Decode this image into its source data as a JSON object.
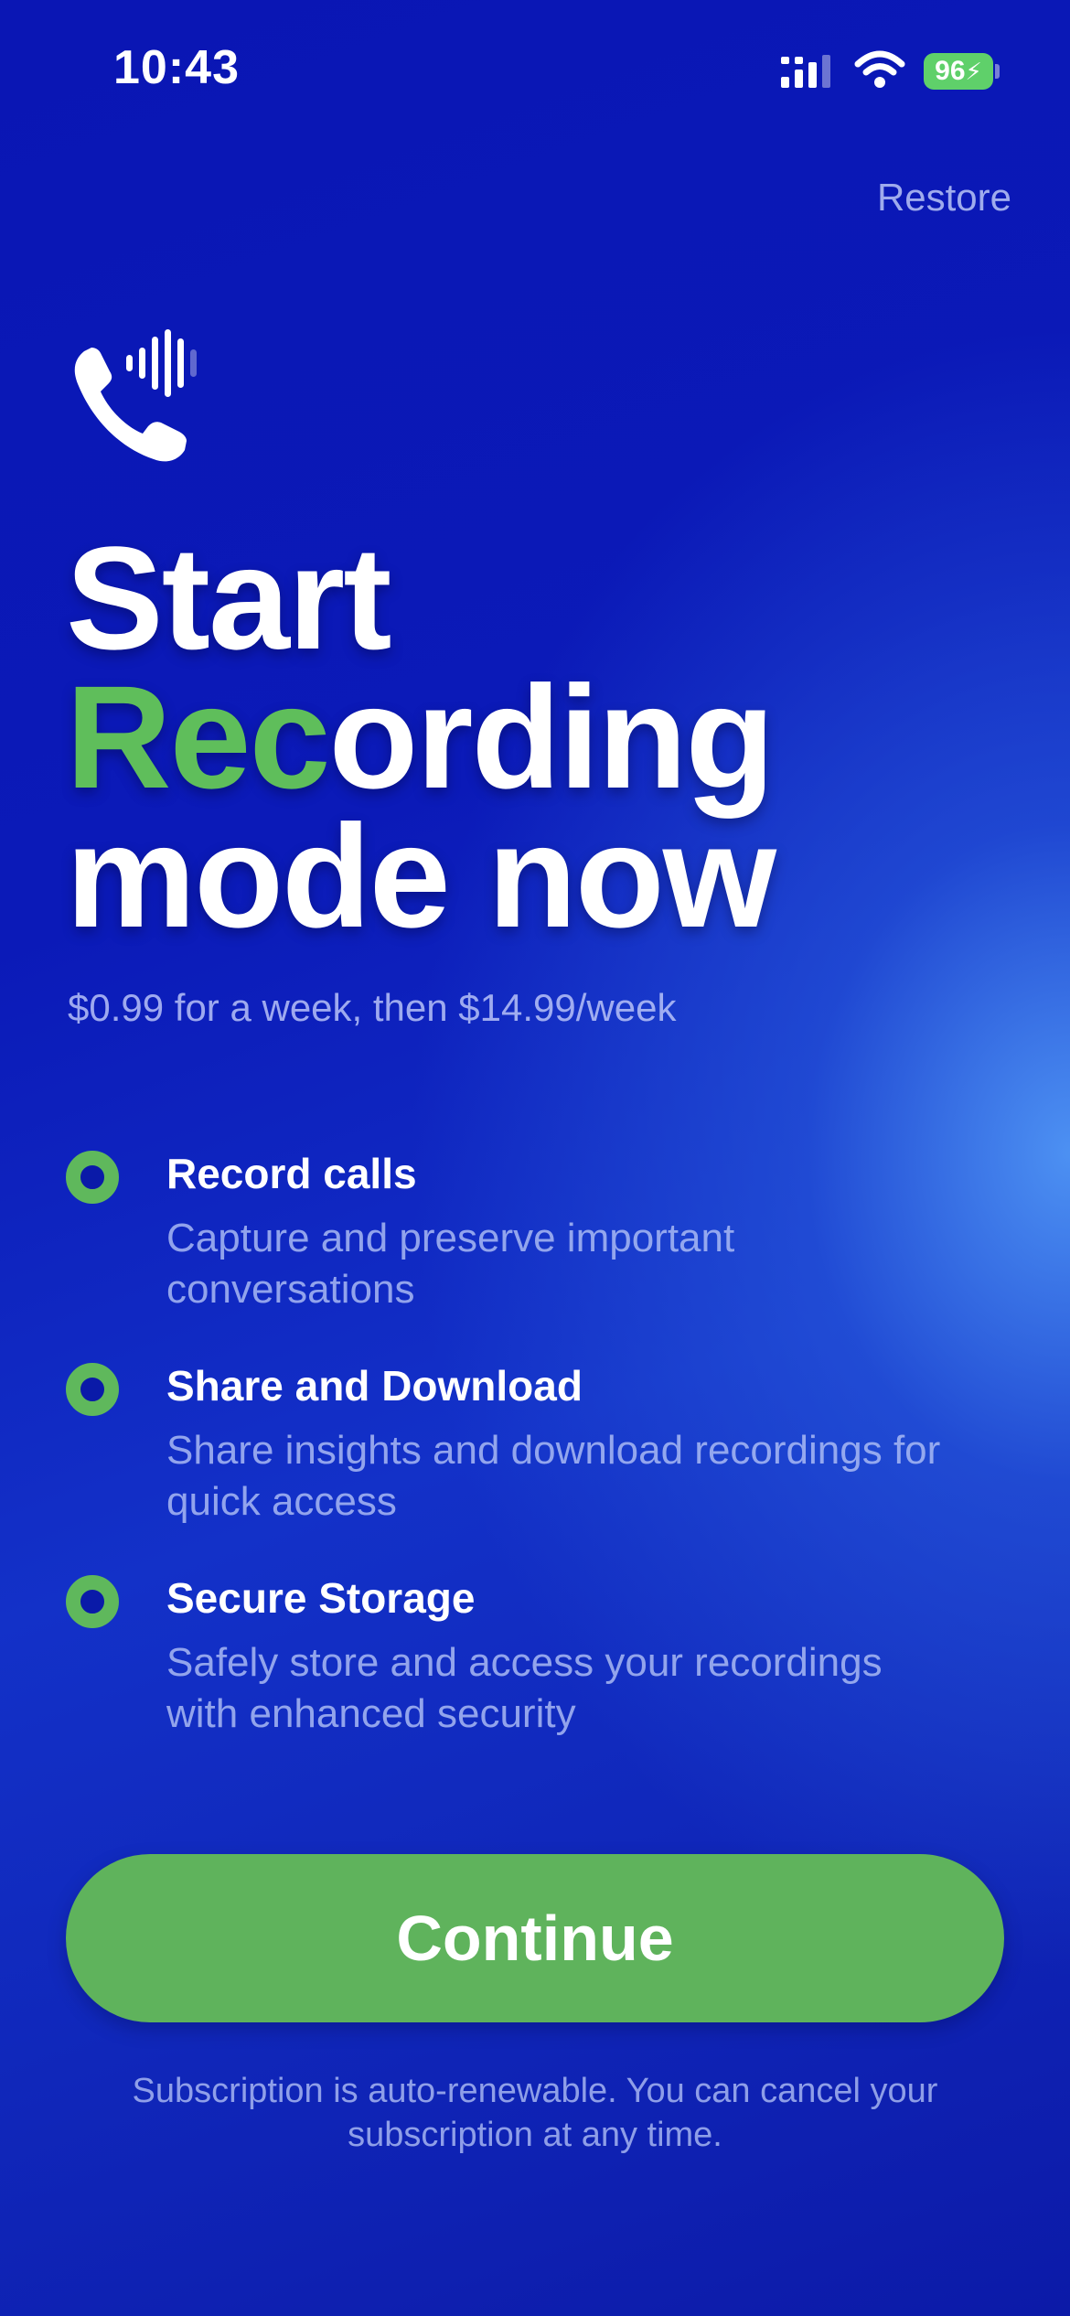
{
  "status_bar": {
    "time": "10:43",
    "battery_level": "96",
    "battery_color": "#5fd06a",
    "icons": [
      "cellular-signal-icon",
      "wifi-icon",
      "battery-charging-icon"
    ]
  },
  "header": {
    "restore_label": "Restore"
  },
  "app_icon": "phone-soundwave-icon",
  "headline": {
    "line1": "Start",
    "line2_accent": "Rec",
    "line2_rest": "ording",
    "line3": "mode now"
  },
  "price_text": "$0.99 for a week, then $14.99/week",
  "features": [
    {
      "title": "Record calls",
      "description": "Capture and preserve important conversations"
    },
    {
      "title": "Share and Download",
      "description": "Share insights and download recordings for quick access"
    },
    {
      "title": "Secure Storage",
      "description": "Safely store and access your recordings with enhanced security"
    }
  ],
  "cta": {
    "continue_label": "Continue"
  },
  "footnote": "Subscription is auto-renewable. You can cancel your subscription at any time.",
  "colors": {
    "accent_green": "#5fb35c",
    "background_blue": "#0b1ab8",
    "highlight_blue": "#5096f5"
  }
}
